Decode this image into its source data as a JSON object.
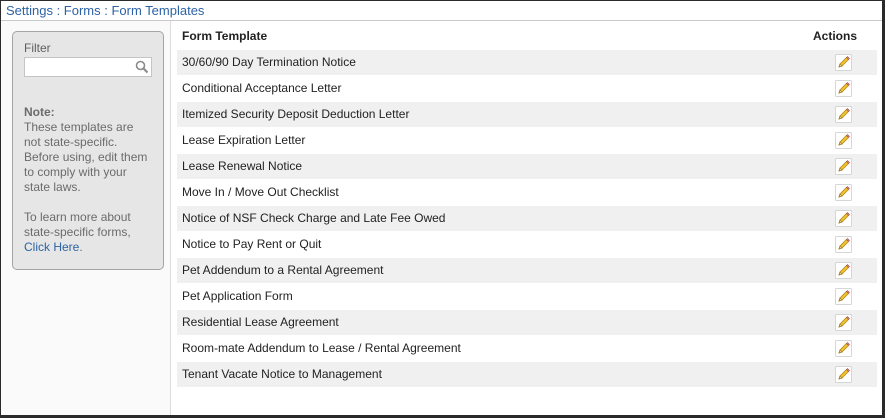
{
  "breadcrumb": "Settings : Forms : Form Templates",
  "filter": {
    "label": "Filter",
    "value": "",
    "placeholder": "",
    "icon": "search-icon"
  },
  "note": {
    "title": "Note:",
    "text1": "These templates are not state-specific. Before using, edit them to comply with your state laws.",
    "text2": "To learn more about state-specific forms,",
    "link": "Click Here",
    "link_suffix": "."
  },
  "table": {
    "columns": [
      "Form Template",
      "Actions"
    ],
    "rows": [
      "30/60/90 Day Termination Notice",
      "Conditional Acceptance Letter",
      "Itemized Security Deposit Deduction Letter",
      "Lease Expiration Letter",
      "Lease Renewal Notice",
      "Move In / Move Out Checklist",
      "Notice of NSF Check Charge and Late Fee Owed",
      "Notice to Pay Rent or Quit",
      "Pet Addendum to a Rental Agreement",
      "Pet Application Form",
      "Residential Lease Agreement",
      "Room-mate Addendum to Lease / Rental Agreement",
      "Tenant Vacate Notice to Management"
    ],
    "action_icon": "edit-pencil-icon"
  },
  "colors": {
    "breadcrumb": "#2d63a5",
    "link": "#2d63a5",
    "row_alt": "#f0f0f0",
    "panel": "#e6e6e6"
  }
}
